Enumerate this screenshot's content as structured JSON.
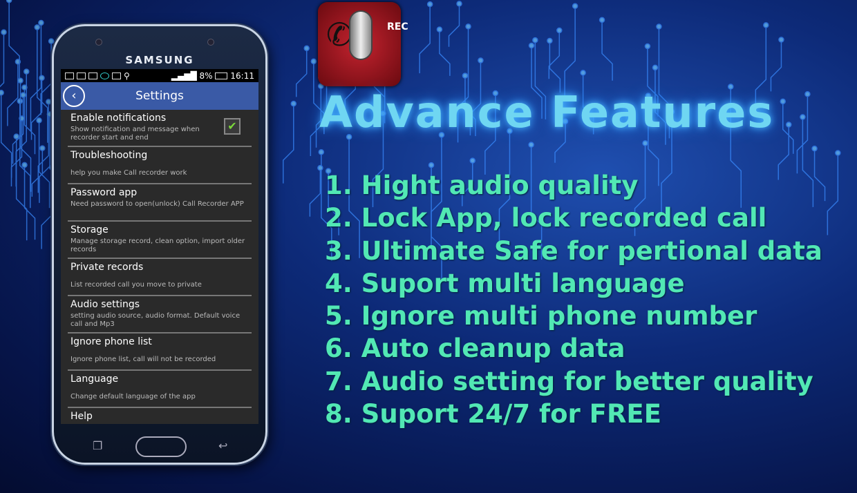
{
  "phone": {
    "brand": "SAMSUNG",
    "status": {
      "battery": "8%",
      "time": "16:11"
    },
    "header": {
      "title": "Settings"
    },
    "settings": [
      {
        "title": "Enable notifications",
        "desc": "Show notification and message when recorder start and end",
        "checked": true
      },
      {
        "title": "Troubleshooting",
        "desc": "help you make Call recorder work"
      },
      {
        "title": "Password app",
        "desc": "Need password to open(unlock) Call Recorder APP"
      },
      {
        "title": "Storage",
        "desc": "Manage storage record, clean option, import older records"
      },
      {
        "title": "Private records",
        "desc": "List recorded call you move to private"
      },
      {
        "title": "Audio settings",
        "desc": "setting audio source, audio format. Default voice call and Mp3"
      },
      {
        "title": "Ignore phone list",
        "desc": "Ignore phone list, call will not be recorded"
      },
      {
        "title": "Language",
        "desc": "Change default language of the app"
      },
      {
        "title": "Help",
        "desc": ""
      }
    ]
  },
  "logo": {
    "text": "REC",
    "icon": "phone-microphone-logo"
  },
  "title": "Advance Features",
  "features": [
    "1. Hight audio quality",
    "2. Lock App, lock recorded call",
    "3. Ultimate Safe for pertional data",
    "4. Suport multi language",
    "5. Ignore multi phone number",
    "6. Auto cleanup data",
    "7. Audio setting for better quality",
    "8. Suport 24/7 for FREE"
  ],
  "colors": {
    "accent": "#52e8b4",
    "title": "#6fd6f2",
    "header": "#3a5aa6",
    "background": "#0d2a78"
  }
}
